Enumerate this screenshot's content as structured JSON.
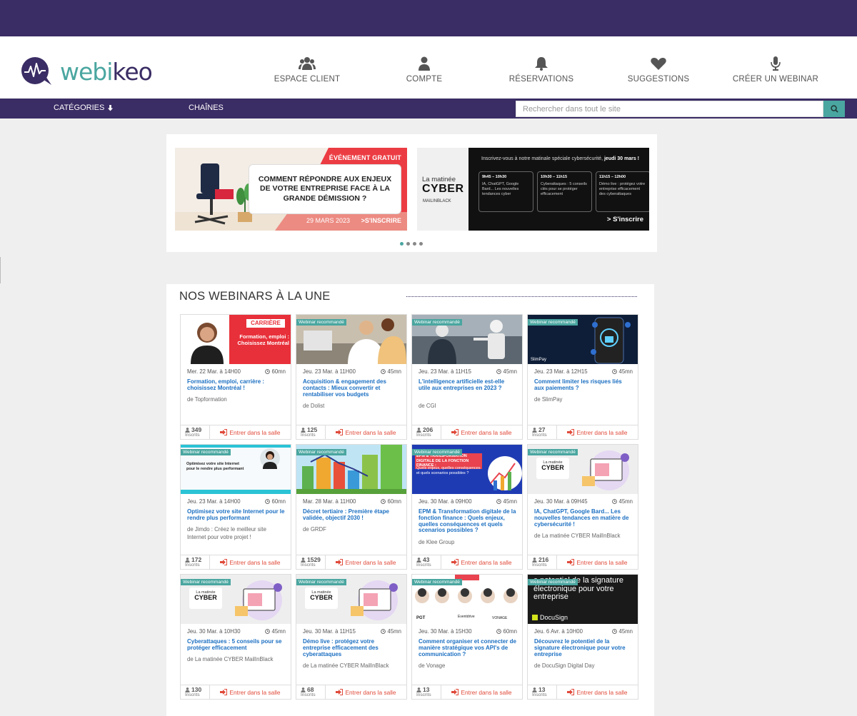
{
  "header": {
    "logo_text_1": "webi",
    "logo_text_2": "keo",
    "nav": [
      {
        "label": "ESPACE CLIENT",
        "icon": "users-icon"
      },
      {
        "label": "COMPTE",
        "icon": "user-icon"
      },
      {
        "label": "RÉSERVATIONS",
        "icon": "bell-icon"
      },
      {
        "label": "SUGGESTIONS",
        "icon": "heart-icon"
      },
      {
        "label": "CRÉER UN WEBINAR",
        "icon": "microphone-icon"
      }
    ]
  },
  "menubar": {
    "categories": "CATÉGORIES",
    "channels": "CHAÎNES",
    "search_placeholder": "Rechercher dans tout le site"
  },
  "carousel": {
    "slide1": {
      "badge": "ÉVÉNEMENT GRATUIT",
      "headline": "COMMENT RÉPONDRE AUX ENJEUX DE VOTRE ENTREPRISE FACE À LA GRANDE DÉMISSION ?",
      "date": "29 MARS 2023",
      "cta": "S'INSCRIRE"
    },
    "slide2": {
      "brand_1": "La matinée",
      "brand_2": "CYBER",
      "brand_3": "MAILINBLACK",
      "head": "Inscrivez-vous à notre matinale spéciale cybersécurité,",
      "head_bold": "jeudi 30 mars !",
      "slots": [
        {
          "time": "9h45 – 10h30",
          "desc": "IA, ChatGPT, Google Bard... Les nouvelles tendances cyber"
        },
        {
          "time": "10h30 – 11h15",
          "desc": "Cyberattaques : 5 conseils clés pour se protéger efficacement"
        },
        {
          "time": "11h15 – 12h00",
          "desc": "Démo live : protégez votre entreprise efficacement des cyberattaques"
        }
      ],
      "cta": "S'inscrire"
    }
  },
  "featured": {
    "title": "NOS WEBINARS À LA UNE",
    "recommended_label": "Webinar recommandé",
    "enter_label": "Entrer dans la salle",
    "registered_label": "Inscrits",
    "cards": [
      {
        "date": "Mer. 22 Mar. à 14H00",
        "duration": "60mn",
        "title": "Formation, emploi, carrière : choisissez Montréal !",
        "host": "de Topformation",
        "count": "349",
        "recommended": false,
        "thumb": "carriere",
        "thumb_text_1": "CARRIÈRE",
        "thumb_text_2": "Formation, emploi : Choisissez Montréal"
      },
      {
        "date": "Jeu. 23 Mar. à 11H00",
        "duration": "45mn",
        "title": "Acquisition & engagement des contacts : Mieux convertir et rentabiliser vos budgets",
        "host": "de Dolist",
        "count": "125",
        "recommended": true,
        "thumb": "dolist"
      },
      {
        "date": "Jeu. 23 Mar. à 11H15",
        "duration": "45mn",
        "title": "L'intelligence artificielle est-elle utile aux entreprises en 2023 ?",
        "host": "de CGI",
        "count": "206",
        "recommended": true,
        "thumb": "cgi"
      },
      {
        "date": "Jeu. 23 Mar. à 12H15",
        "duration": "45mn",
        "title": "Comment limiter les risques liés aux paiements ?",
        "host": "de SlimPay",
        "count": "27",
        "recommended": true,
        "thumb": "slimpay"
      },
      {
        "date": "Jeu. 23 Mar. à 14H00",
        "duration": "60mn",
        "title": "Optimisez votre site Internet pour le rendre plus performant",
        "host": "de Jimdo : Créez le meilleur site Internet pour votre projet !",
        "count": "172",
        "recommended": true,
        "thumb": "jimdo",
        "thumb_text_1": "Optimisez votre site Internet pour le rendre plus performant"
      },
      {
        "date": "Mar. 28 Mar. à 11H00",
        "duration": "60mn",
        "title": "Décret tertiaire : Première étape validée, objectif 2030 !",
        "host": "de GRDF",
        "count": "1529",
        "recommended": true,
        "thumb": "grdf"
      },
      {
        "date": "Jeu. 30 Mar. à 09H00",
        "duration": "45mn",
        "title": "EPM & Transformation digitale de la fonction finance : Quels enjeux, quelles conséquences et quels scenarios possibles ?",
        "host": "de Klee Group",
        "count": "43",
        "recommended": true,
        "thumb": "klee",
        "thumb_text_1": "EPM & TRANSFORMATION DIGITALE DE LA FONCTION FINANCE :",
        "thumb_text_2": "Quels enjeux, quelles conséquences et quels scenarios possibles ?"
      },
      {
        "date": "Jeu. 30 Mar. à 09H45",
        "duration": "45mn",
        "title": "IA, ChatGPT, Google Bard... Les nouvelles tendances en matière de cybersécurité !",
        "host": "de La matinée CYBER MailInBlack",
        "count": "216",
        "recommended": true,
        "thumb": "cyber"
      },
      {
        "date": "Jeu. 30 Mar. à 10H30",
        "duration": "45mn",
        "title": "Cyberattaques : 5 conseils pour se protéger efficacement",
        "host": "de La matinée CYBER MailInBlack",
        "count": "130",
        "recommended": true,
        "thumb": "cyber"
      },
      {
        "date": "Jeu. 30 Mar. à 11H15",
        "duration": "45mn",
        "title": "Démo live : protégez votre entreprise efficacement des cyberattaques",
        "host": "de La matinée CYBER MailInBlack",
        "count": "68",
        "recommended": true,
        "thumb": "cyber"
      },
      {
        "date": "Jeu. 30 Mar. à 15H30",
        "duration": "60mn",
        "title": "Comment organiser et connecter de manière stratégique vos API's de communication ?",
        "host": "de Vonage",
        "count": "13",
        "recommended": true,
        "thumb": "vonage"
      },
      {
        "date": "Jeu. 6 Avr. à 10H00",
        "duration": "45mn",
        "title": "Découvrez le potentiel de la signature électronique pour votre entreprise",
        "host": "de DocuSign Digital Day",
        "count": "13",
        "recommended": true,
        "thumb": "docusign",
        "thumb_text_1": "e potentiel de la signature électronique pour votre entreprise",
        "thumb_text_2": "DocuSign"
      }
    ]
  },
  "colors": {
    "brand_purple": "#3a2c64",
    "brand_teal": "#4aa6a0",
    "link_blue": "#1b6fc2",
    "enter_red": "#e04a3a"
  }
}
